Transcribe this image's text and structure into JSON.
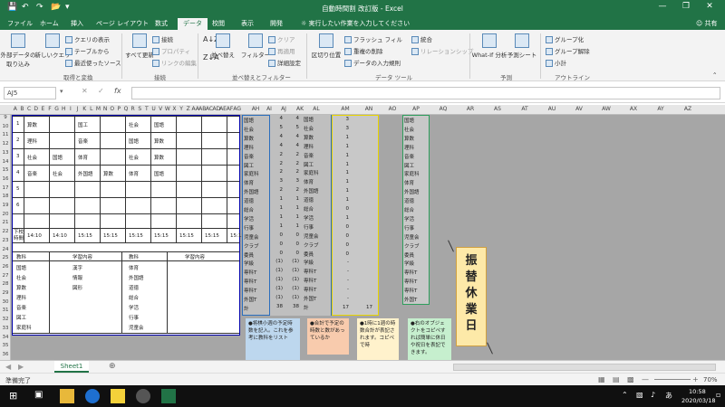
{
  "window": {
    "title": "自動時間割 改訂版 - Excel",
    "signin": "共有"
  },
  "tabs": [
    "ファイル",
    "ホーム",
    "挿入",
    "ページ レイアウト",
    "数式",
    "データ",
    "校閲",
    "表示",
    "開発"
  ],
  "tell_me": "実行したい作業を入力してください",
  "ribbon": {
    "get_external": "外部データの取り込み",
    "new_query": "新しいクエリ",
    "show_query": "クエリの表示",
    "from_table": "テーブルから",
    "recent_sources": "最近使ったソース",
    "group1": "取得と変換",
    "refresh_all": "すべて更新",
    "connections": "接続",
    "properties": "プロパティ",
    "edit_links": "リンクの編集",
    "group2": "接続",
    "sort": "並べ替え",
    "filter": "フィルター",
    "clear": "クリア",
    "reapply": "再適用",
    "advanced": "詳細設定",
    "group3": "並べ替えとフィルター",
    "text_to_cols": "区切り位置",
    "flash_fill": "フラッシュ フィル",
    "remove_dup": "重複の削除",
    "data_valid": "データの入力規則",
    "consolidate": "統合",
    "relationships": "リレーションシップ",
    "group4": "データ ツール",
    "what_if": "What-If 分析",
    "forecast": "予測シート",
    "group5": "予測",
    "group_btn": "グループ化",
    "ungroup": "グループ解除",
    "subtotal": "小計",
    "group6": "アウトライン"
  },
  "formula_bar": {
    "name_box": "AJ5",
    "fx": "fx"
  },
  "columns_left": [
    "A",
    "B",
    "C",
    "D",
    "E",
    "F",
    "G",
    "H",
    "I",
    "J",
    "K",
    "L",
    "M",
    "N",
    "O",
    "P",
    "Q",
    "R",
    "S",
    "T",
    "U",
    "V",
    "W",
    "X",
    "Y",
    "Z",
    "AA",
    "AB",
    "AC",
    "AD",
    "AE",
    "AF",
    "AG"
  ],
  "columns_right": [
    "AH",
    "AI",
    "AJ",
    "AK",
    "AL",
    "AM",
    "AN",
    "AO",
    "AP",
    "AQ",
    "AR",
    "AS",
    "AT",
    "AU",
    "AV",
    "AW",
    "AX",
    "AY",
    "AZ"
  ],
  "rows": [
    "9",
    "10",
    "11",
    "12",
    "13",
    "14",
    "15",
    "16",
    "17",
    "18",
    "19",
    "20",
    "21",
    "22",
    "23",
    "24",
    "25",
    "26",
    "27",
    "28",
    "29",
    "30",
    "31",
    "32",
    "33",
    "34",
    "35",
    "36"
  ],
  "timetable": {
    "periods": [
      "1",
      "2",
      "3",
      "4",
      "5",
      "6"
    ],
    "period_rows": [
      [
        "算数",
        "",
        "国工",
        "",
        "社会",
        "国語"
      ],
      [
        "理科",
        "",
        "音楽",
        "",
        "国語",
        "算数"
      ],
      [
        "社会",
        "国語",
        "体育",
        "",
        "社会",
        "算数"
      ],
      [
        "音楽",
        "社会",
        "外国語",
        "算数",
        "体育",
        "国語"
      ],
      [
        "",
        "",
        "",
        "",
        "",
        ""
      ]
    ],
    "end_label": "下校時間",
    "end_times": [
      "14:10",
      "14:10",
      "15:15",
      "15:15",
      "15:15",
      "15:15",
      "15:15",
      "15:15",
      "15:15"
    ],
    "legend_headers": [
      "教科",
      "学習内容",
      "教科",
      "学習内容"
    ],
    "legend_left": [
      "国語",
      "社会",
      "算数",
      "理科",
      "音楽",
      "図工",
      "家庭科"
    ],
    "legend_mid": [
      "漢字",
      "情報",
      "図形",
      "",
      "",
      "",
      ""
    ],
    "legend_right": [
      "体育",
      "外国語",
      "道徳",
      "総合",
      "学活",
      "行事",
      "児童会"
    ]
  },
  "grid_list": {
    "subjects": [
      "国語",
      "社会",
      "算数",
      "理科",
      "音楽",
      "図工",
      "家庭科",
      "体育",
      "外国語",
      "道徳",
      "総合",
      "学活",
      "行事",
      "児童会",
      "クラブ",
      "委員",
      "学級",
      "専科T",
      "専科T",
      "専科T",
      "外国T",
      "計"
    ],
    "ai_values": [
      "4",
      "5",
      "4",
      "4",
      "2",
      "2",
      "2",
      "3",
      "2",
      "1",
      "1",
      "1",
      "1",
      "0",
      "0",
      "0",
      "(1)",
      "(1)",
      "(1)",
      "(1)",
      "(1)",
      "38"
    ],
    "aj_values": [
      "4",
      "5",
      "4",
      "4",
      "2",
      "2",
      "2",
      "3",
      "2",
      "1",
      "1",
      "1",
      "1",
      "0",
      "0",
      "0",
      "(1)",
      "(1)",
      "(1)",
      "(1)",
      "(1)",
      "38"
    ],
    "al_values": [
      "3",
      "3",
      "1",
      "1",
      "1",
      "1",
      "1",
      "1",
      "1",
      "1",
      "0",
      "1",
      "0",
      "0",
      "0",
      "0",
      "-",
      "-",
      "-",
      "-",
      "-",
      "17"
    ],
    "al_total": "17",
    "ao_list": [
      "国語",
      "社会",
      "算数",
      "理科",
      "音楽",
      "図工",
      "家庭科",
      "体育",
      "外国語",
      "道徳",
      "総合",
      "学活",
      "行事",
      "児童会",
      "クラブ",
      "委員",
      "学級",
      "専科T",
      "専科T",
      "専科T",
      "外国T"
    ]
  },
  "notes": [
    "●将棋小週の予定時数を記入。これを参考に教科をリスト",
    "●合計で予定の時数と数があっているか",
    "●1時に1週の時数合計が表記されます。コピペで時",
    "●右のオブジェクトをコピペすれば簡単に休日や祝日を表記できます。"
  ],
  "holiday_label": [
    "振",
    "替",
    "休",
    "業",
    "日"
  ],
  "sheet_tab": "Sheet1",
  "status": {
    "ready": "準備完了",
    "zoom": "70%"
  },
  "taskbar": {
    "ime": "あ",
    "time": "10:58",
    "date": "2020/03/18"
  },
  "colors": {
    "excel_green": "#217346",
    "sheet_gray": "#a6a6a6",
    "blue_border": "#2a6dbd",
    "yellow_border": "#e8d400",
    "green_border": "#2e9e5c",
    "note_peach": "#f8cbad",
    "note_blue": "#bdd7ee",
    "note_yellow": "#fff2cc",
    "note_green": "#c6efce",
    "holiday_fill": "#fde9a8"
  }
}
